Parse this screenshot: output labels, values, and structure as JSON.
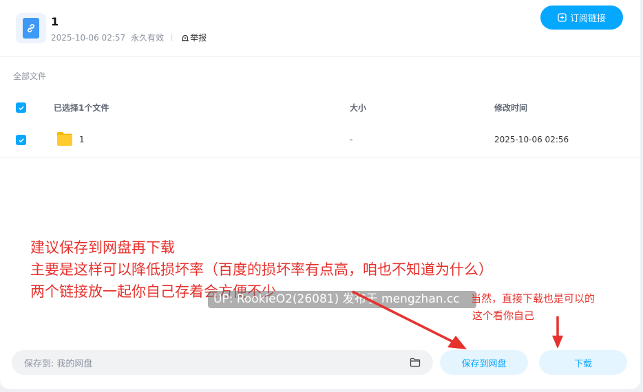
{
  "header": {
    "share_title": "1",
    "date": "2025-10-06 02:57",
    "validity": "永久有效",
    "report_label": "举报",
    "subscribe_label": "订阅链接"
  },
  "breadcrumb": "全部文件",
  "table": {
    "headers": {
      "name": "已选择1个文件",
      "size": "大小",
      "modified": "修改时间"
    },
    "rows": [
      {
        "name": "1",
        "size": "-",
        "modified": "2025-10-06 02:56",
        "checked": true,
        "icon": "folder-icon"
      }
    ]
  },
  "bottom": {
    "save_to_label": "保存到:",
    "save_to_target": "我的网盘",
    "save_button": "保存到网盘",
    "download_button": "下载"
  },
  "annotation": {
    "line1": "建议保存到网盘再下载",
    "line2": "主要是这样可以降低损坏率（百度的损坏率有点高，咱也不知道为什么）",
    "line3": "两个链接放一起你自己存着会方便不少",
    "side_line1": "当然，直接下载也是可以的",
    "side_line2": "这个看你自己",
    "color": "#e6322d"
  },
  "watermark": "UP: RookieO2(26081) 发布于 mengzhan.cc",
  "colors": {
    "accent": "#06a7ff",
    "accent_light": "#e5f5ff",
    "annotation_red": "#e6322d"
  }
}
